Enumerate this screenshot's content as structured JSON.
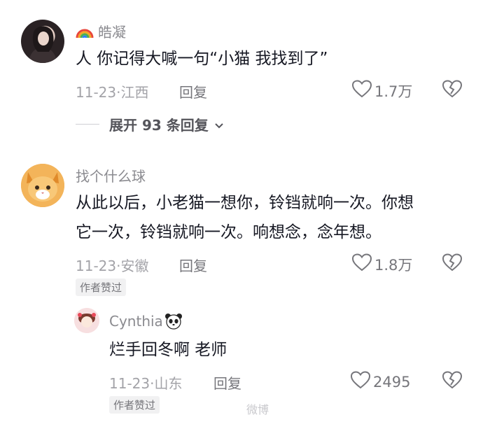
{
  "comments": [
    {
      "username": "皓凝",
      "username_emoji": "rainbow-emoji",
      "text": "人 你记得大喊一句“小猫 我找到了”",
      "date": "11-23",
      "location": "江西",
      "reply_label": "回复",
      "likes": "1.7万",
      "expand_label": "展开 93 条回复"
    },
    {
      "username": "找个什么球",
      "text_line1": "从此以后，小老猫一想你，铃铛就响一次。你想",
      "text_line2": "它一次，铃铛就响一次。响想念，念年想。",
      "date": "11-23",
      "location": "安徽",
      "reply_label": "回复",
      "likes": "1.8万",
      "badge": "作者赞过"
    },
    {
      "username": "Cynthia",
      "username_emoji": "panda-emoji",
      "text": "烂手回冬啊 老师",
      "date": "11-23",
      "location": "山东",
      "reply_label": "回复",
      "likes": "2495",
      "badge": "作者赞过"
    }
  ],
  "separator": "·",
  "watermark": "微博"
}
